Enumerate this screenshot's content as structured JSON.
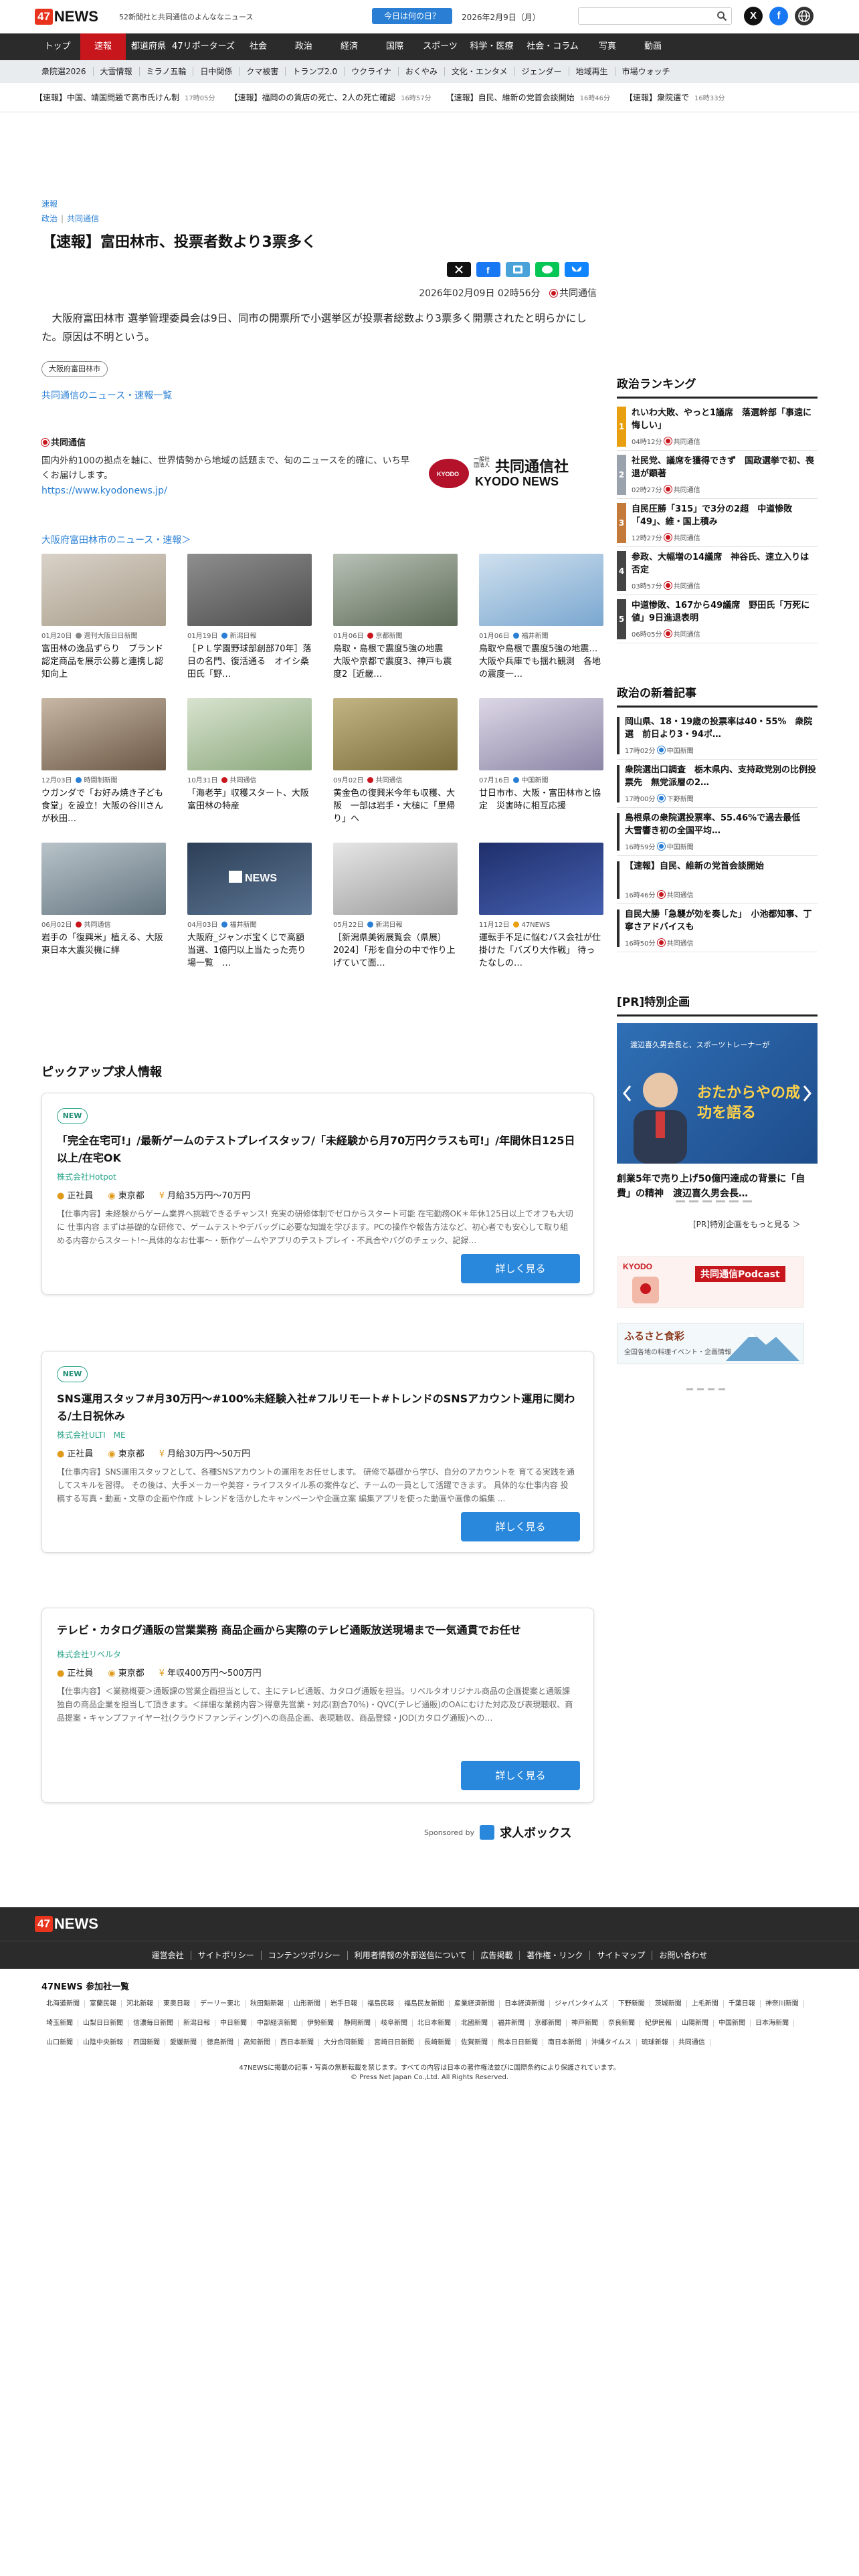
{
  "header": {
    "logo_num": "47",
    "logo_text": "NEWS",
    "tagline": "52新聞社と共同通信のよんななニュース",
    "today_button": "今日は何の日？",
    "date": "2026年2月9日（月）",
    "search_placeholder": ""
  },
  "nav": {
    "items": [
      "トップ",
      "速報",
      "都道府県",
      "47リポーターズ",
      "社会",
      "政治",
      "経済",
      "国際",
      "スポーツ",
      "科学・医療",
      "社会・コラム",
      "写真",
      "動画"
    ],
    "active_index": 1
  },
  "subnav": {
    "items": [
      "衆院選2026",
      "大雪情報",
      "ミラノ五輪",
      "日中関係",
      "クマ被害",
      "トランプ2.0",
      "ウクライナ",
      "おくやみ",
      "文化・エンタメ",
      "ジェンダー",
      "地域再生",
      "市場ウォッチ"
    ]
  },
  "ticker": {
    "items": [
      {
        "text": "【速報】中国、靖国問題で高市氏けん制",
        "time": "17時05分"
      },
      {
        "text": "【速報】福岡のの貨店の死亡、2人の死亡確認",
        "time": "16時57分"
      },
      {
        "text": "【速報】自民、維新の党首会談開始",
        "time": "16時46分"
      },
      {
        "text": "【速報】衆院選で",
        "time": "16時33分"
      }
    ]
  },
  "article": {
    "crumb_top": "速報",
    "crumb_a": "政治",
    "crumb_b": "共同通信",
    "title": "【速報】富田林市、投票者数より3票多く",
    "date": "2026年02月09日",
    "time": "02時56分",
    "source": "共同通信",
    "body": "大阪府富田林市 選挙管理委員会は9日、同市の開票所で小選挙区が投票者総数より3票多く開票されたと明らかにした。原因は不明という。",
    "tag": "大阪府富田林市",
    "more_link": "共同通信のニュース・速報一覧"
  },
  "kyodo": {
    "header": "共同通信",
    "desc": "国内外約100の拠点を軸に、世界情勢から地域の話題まで、旬のニュースを的確に、いち早くお届けします。",
    "url": "https://www.kyodonews.jp/",
    "logo_line1": "一般社団法人",
    "logo_line2": "共同通信社",
    "logo_line3": "KYODO NEWS"
  },
  "section_link": "大阪府富田林市のニュース・速報＞",
  "grid": [
    {
      "date": "01月20日",
      "src": "週刊大阪日日新聞",
      "title": "富田林の逸品ずらり　ブランド認定商品を展示公募と連携し認知向上"
    },
    {
      "date": "01月19日",
      "src": "新潟日報",
      "title": "［ＰＬ学園野球部創部70年］落日の名門、復活通る　オイシ桑田氏「野…"
    },
    {
      "date": "01月06日",
      "src": "京都新聞",
      "title": "鳥取・島根で震度5強の地震　大阪や京都で震度3、神戸も震度2［近畿…"
    },
    {
      "date": "01月06日",
      "src": "福井新聞",
      "title": "鳥取や島根で震度5強の地震…大阪や兵庫でも揺れ観測　各地の震度一…"
    },
    {
      "date": "12月03日",
      "src": "時間制新聞",
      "title": "ウガンダで「お好み焼き子ども食堂」を設立！大阪の谷川さんが秋田…"
    },
    {
      "date": "10月31日",
      "src": "共同通信",
      "title": "「海老芋」収穫スタート、大阪　富田林の特産"
    },
    {
      "date": "09月02日",
      "src": "共同通信",
      "title": "黄金色の復興米今年も収穫、大阪　一部は岩手・大槌に「里帰り」へ"
    },
    {
      "date": "07月16日",
      "src": "中国新聞",
      "title": "廿日市市、大阪・富田林市と協定　災害時に相互応援"
    },
    {
      "date": "06月02日",
      "src": "共同通信",
      "title": "岩手の「復興米」植える、大阪　東日本大震災機に絆"
    },
    {
      "date": "04月03日",
      "src": "福井新聞",
      "title": "大阪府_ジャンボ宝くじで高額当選、1億円以上当たった売り場一覧　…"
    },
    {
      "date": "05月22日",
      "src": "新潟日報",
      "title": "［新潟県美術展覧会（県展）2024］「形を自分の中で作り上げていて面…"
    },
    {
      "date": "11月12日",
      "src": "47NEWS",
      "title": "運転手不足に悩むバス会社が仕掛けた「バズり大作戦」 待ったなしの…"
    }
  ],
  "jobs": {
    "header": "ピックアップ求人情報",
    "new_label": "NEW",
    "detail_label": "詳しく見る",
    "items": [
      {
        "title": "「完全在宅可!」/最新ゲームのテストプレイスタッフ/「未経験から月70万円クラスも可!」/年間休日125日以上/在宅OK",
        "company": "株式会社Hotpot",
        "type": "正社員",
        "loc": "東京都",
        "salary": "月給35万円〜70万円",
        "desc": "【仕事内容】未経験からゲーム業界へ挑戦できるチャンス! 充実の研修体制でゼロからスタート可能 在宅勤務OK＊年休125日以上でオフも大切に 仕事内容 まずは基礎的な研修で、ゲームテストやデバッグに必要な知識を学びます。PCの操作や報告方法など、初心者でも安心して取り組める内容からスタート!～具体的なお仕事～・新作ゲームやアプリのテストプレイ・不具合やバグのチェック、記録…",
        "is_new": true
      },
      {
        "title": "SNS運用スタッフ#月30万円～#100%未経験入社#フルリモ一ト#トレンドのSNSアカウント運用に関わる/土日祝休み",
        "company": "株式会社ULTI　ME",
        "type": "正社員",
        "loc": "東京都",
        "salary": "月給30万円〜50万円",
        "desc": "【仕事内容】SNS運用スタッフとして、各種SNSアカウントの運用をお任せします。 研修で基礎から学び、自分のアカウントを 育てる実践を通してスキルを習得。 その後は、大手メーカーや美容・ライフスタイル系の案件など、チームの一員として活躍できます。 具体的な仕事内容 投稿する写真・動画・文章の企画や作成 トレンドを活かしたキャンペーンや企画立案 編集アプリを使った動画や画像の編集 ...",
        "is_new": true
      },
      {
        "title": "テレビ・カタログ通販の営業業務 商品企画から実際のテレビ通販放送現場まで一気通貫でお任せ",
        "company": "株式会社リベルタ",
        "type": "正社員",
        "loc": "東京都",
        "salary": "年収400万円〜500万円",
        "desc": "【仕事内容】＜業務概要＞通販課の営業企画担当として、主にテレビ通販、カタログ通販を担当。リベルタオリジナル商品の企画提案と通販課独自の商品企業を担当して頂きます。＜詳細な業務内容＞得意先営業・対応(割合70%)・QVC(テレビ通販)のOAにむけた対応及び表現聴収、商品提案・キャンプファイヤー社(クラウドファンディング)への商品企画、表現聴収、商品登録・JOD(カタログ通販)への…",
        "is_new": false
      }
    ],
    "sponsored_label": "Sponsored by",
    "sponsor_name": "求人ボックス"
  },
  "ranking": {
    "header": "政治ランキング",
    "items": [
      {
        "n": "1",
        "title": "れいわ大敗、やっと1議席　落選幹部「事遠に悔しい」",
        "time": "04時12分",
        "src": "共同通信"
      },
      {
        "n": "2",
        "title": "社民党、議席を獲得できず　国政選挙で初、喪退が顕著",
        "time": "02時27分",
        "src": "共同通信"
      },
      {
        "n": "3",
        "title": "自民圧勝「315」で3分の2超　中道惨敗「49」、維・国上積み",
        "time": "12時27分",
        "src": "共同通信"
      },
      {
        "n": "4",
        "title": "参政、大幅増の14議席　神谷氏、速立入りは否定",
        "time": "03時57分",
        "src": "共同通信"
      },
      {
        "n": "5",
        "title": "中道惨敗、167から49議席　野田氏「万死に値」9日進退表明",
        "time": "06時05分",
        "src": "共同通信"
      }
    ]
  },
  "latest": {
    "header": "政治の新着記事",
    "items": [
      {
        "title": "岡山県、18・19歳の投票率は40・55%　衆院選　前日より3・94ポ…",
        "time": "17時02分",
        "src": "中国新聞"
      },
      {
        "title": "衆院選出口調査　栃木県内、支持政党別の比例投票先　無党派層の2…",
        "time": "17時00分",
        "src": "下野新聞"
      },
      {
        "title": "島根県の衆院選投票率、55.46%で過去最低　大雪響き初の全国平均…",
        "time": "16時59分",
        "src": "中国新聞"
      },
      {
        "title": "【速報】自民、維新の党首会談開始",
        "time": "16時46分",
        "src": "共同通信"
      },
      {
        "title": "自民大勝「急襲が効を奏した」　小池都知事、丁寧さアドバイスも",
        "time": "16時50分",
        "src": "共同通信"
      }
    ]
  },
  "pr": {
    "header": "[PR]特別企画",
    "caption": "創業5年で売り上げ50億円達成の背景に「自費」の精神　渡辺喜久男会長…",
    "more": "[PR]特別企画をもっと見る ＞",
    "banner_text": "おたからやの成功を語る",
    "banner_sub": "渡辺喜久男会長と、スポーツトレーナーが"
  },
  "banners": {
    "podcast_brand": "KYODO",
    "podcast_title": "共同通信Podcast",
    "furusato": "ふるさと食彩",
    "furusato_sub": "全国各地の料理イベント・企画情報"
  },
  "footer": {
    "links": [
      "運営会社",
      "サイトポリシー",
      "コンテンツポリシー",
      "利用者情報の外部送信について",
      "広告掲載",
      "著作権・リンク",
      "サイトマップ",
      "お問い合わせ"
    ],
    "members_header": "47NEWS 参加社一覧",
    "members": [
      "北海道新聞",
      "室蘭民報",
      "河北新報",
      "東奥日報",
      "デーリー東北",
      "秋田魁新報",
      "山形新聞",
      "岩手日報",
      "福島民報",
      "福島民友新聞",
      "産業経済新聞",
      "日本経済新聞",
      "ジャパンタイムズ",
      "下野新聞",
      "茨城新聞",
      "上毛新聞",
      "千葉日報",
      "神奈川新聞",
      "埼玉新聞",
      "山梨日日新聞",
      "信濃毎日新聞",
      "新潟日報",
      "中日新聞",
      "中部経済新聞",
      "伊勢新聞",
      "静岡新聞",
      "岐阜新聞",
      "北日本新聞",
      "北國新聞",
      "福井新聞",
      "京都新聞",
      "神戸新聞",
      "奈良新聞",
      "紀伊民報",
      "山陽新聞",
      "中国新聞",
      "日本海新聞",
      "山口新聞",
      "山陰中央新報",
      "四国新聞",
      "愛媛新聞",
      "徳島新聞",
      "高知新聞",
      "西日本新聞",
      "大分合同新聞",
      "宮崎日日新聞",
      "長崎新聞",
      "佐賀新聞",
      "熊本日日新聞",
      "南日本新聞",
      "沖縄タイムス",
      "琉球新報",
      "共同通信"
    ],
    "copy1": "47NEWSに掲載の記事・写真の無断転載を禁じます。すべての内容は日本の著作権法並びに国際条約により保護されています。",
    "copy2": "© Press Net Japan Co.,Ltd. All Rights Reserved."
  }
}
